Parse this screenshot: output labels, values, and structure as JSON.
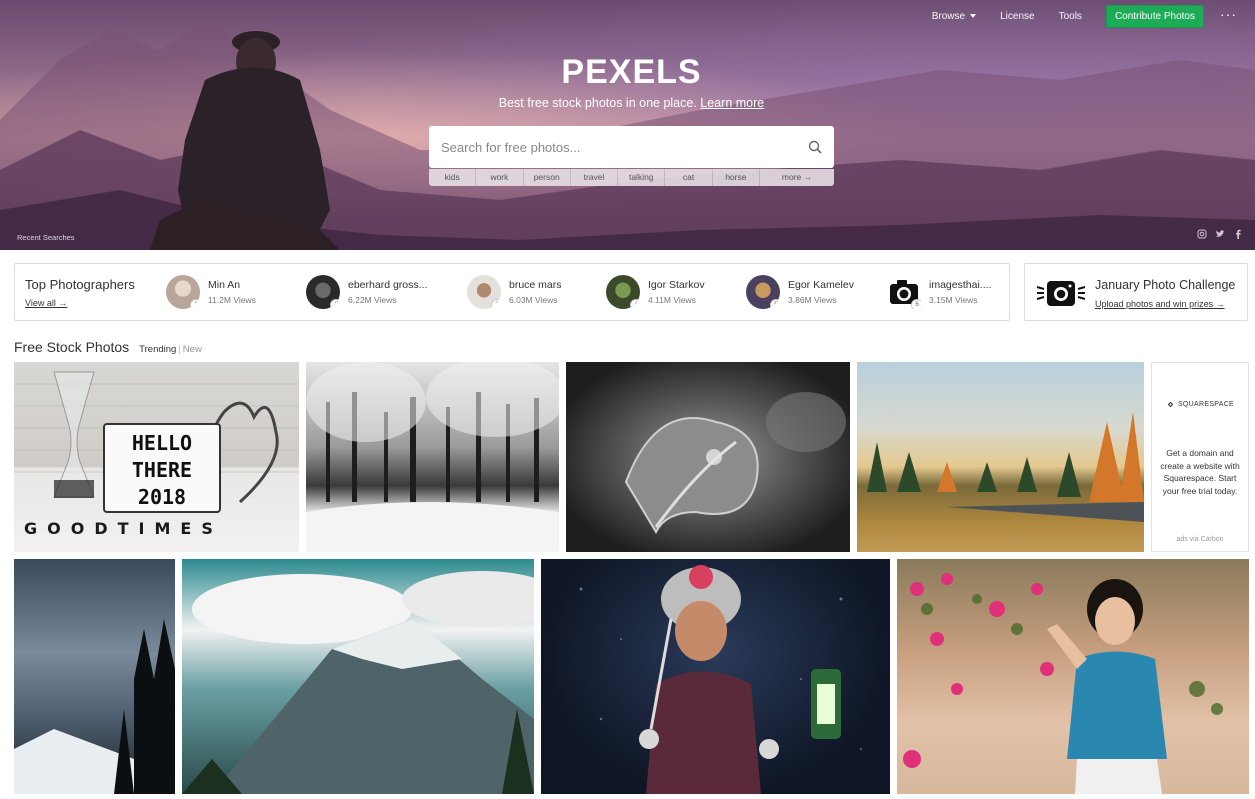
{
  "nav": {
    "browse": "Browse",
    "license": "License",
    "tools": "Tools",
    "contribute": "Contribute Photos",
    "more": "···"
  },
  "hero": {
    "logo": "PEXELS",
    "tagline": "Best free stock photos in one place.",
    "learn_more": "Learn more",
    "search_placeholder": "Search for free photos...",
    "tags": [
      "kids",
      "work",
      "person",
      "travel",
      "talking",
      "cat",
      "horse",
      "more →"
    ],
    "recent_searches": "Recent Searches",
    "social_icons": [
      "instagram-icon",
      "twitter-icon",
      "facebook-icon"
    ]
  },
  "photographers": {
    "title": "Top Photographers",
    "view_all": "View all →",
    "items": [
      {
        "name": "Min An",
        "views": "11.2M Views",
        "rank": "1"
      },
      {
        "name": "eberhard gross...",
        "views": "6.22M Views",
        "rank": "2"
      },
      {
        "name": "bruce mars",
        "views": "6.03M Views",
        "rank": "3"
      },
      {
        "name": "Igor Starkov",
        "views": "4.11M Views",
        "rank": "4"
      },
      {
        "name": "Egor Kamelev",
        "views": "3.86M Views",
        "rank": "5"
      },
      {
        "name": "imagesthai....",
        "views": "3.15M Views",
        "rank": "6"
      }
    ]
  },
  "challenge": {
    "title": "January Photo Challenge",
    "link": "Upload photos and win prizes →"
  },
  "section": {
    "title": "Free Stock Photos",
    "trending": "Trending",
    "separator": "|",
    "new": "New"
  },
  "photos": {
    "hello_sign": [
      "HELLO",
      "THERE",
      "2018"
    ],
    "good_times": "GOODTIMES"
  },
  "ad": {
    "brand": "SQUARESPACE",
    "text": "Get a domain and create a website with Squarespace. Start your free trial today.",
    "via": "ads via Carbon"
  }
}
